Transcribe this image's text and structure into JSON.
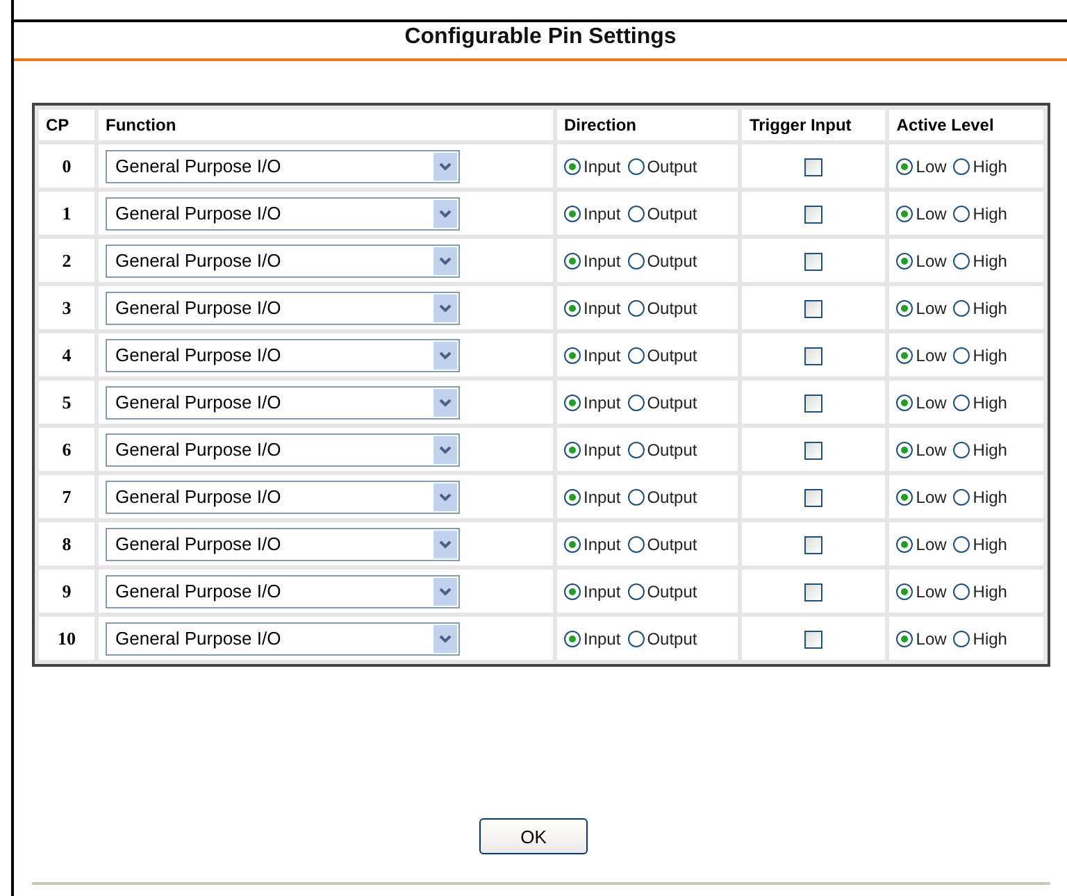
{
  "title": "Configurable Pin Settings",
  "table": {
    "columns": [
      "CP",
      "Function",
      "Direction",
      "Trigger Input",
      "Active Level"
    ],
    "rows": [
      {
        "cp": "0",
        "function": "General Purpose I/O",
        "direction": [
          {
            "label": "Input",
            "selected": true
          },
          {
            "label": "Output",
            "selected": false
          }
        ],
        "trigger_checked": false,
        "active_level": [
          {
            "label": "Low",
            "selected": true
          },
          {
            "label": "High",
            "selected": false
          }
        ]
      },
      {
        "cp": "1",
        "function": "General Purpose I/O",
        "direction": [
          {
            "label": "Input",
            "selected": true
          },
          {
            "label": "Output",
            "selected": false
          }
        ],
        "trigger_checked": false,
        "active_level": [
          {
            "label": "Low",
            "selected": true
          },
          {
            "label": "High",
            "selected": false
          }
        ]
      },
      {
        "cp": "2",
        "function": "General Purpose I/O",
        "direction": [
          {
            "label": "Input",
            "selected": true
          },
          {
            "label": "Output",
            "selected": false
          }
        ],
        "trigger_checked": false,
        "active_level": [
          {
            "label": "Low",
            "selected": true
          },
          {
            "label": "High",
            "selected": false
          }
        ]
      },
      {
        "cp": "3",
        "function": "General Purpose I/O",
        "direction": [
          {
            "label": "Input",
            "selected": true
          },
          {
            "label": "Output",
            "selected": false
          }
        ],
        "trigger_checked": false,
        "active_level": [
          {
            "label": "Low",
            "selected": true
          },
          {
            "label": "High",
            "selected": false
          }
        ]
      },
      {
        "cp": "4",
        "function": "General Purpose I/O",
        "direction": [
          {
            "label": "Input",
            "selected": true
          },
          {
            "label": "Output",
            "selected": false
          }
        ],
        "trigger_checked": false,
        "active_level": [
          {
            "label": "Low",
            "selected": true
          },
          {
            "label": "High",
            "selected": false
          }
        ]
      },
      {
        "cp": "5",
        "function": "General Purpose I/O",
        "direction": [
          {
            "label": "Input",
            "selected": true
          },
          {
            "label": "Output",
            "selected": false
          }
        ],
        "trigger_checked": false,
        "active_level": [
          {
            "label": "Low",
            "selected": true
          },
          {
            "label": "High",
            "selected": false
          }
        ]
      },
      {
        "cp": "6",
        "function": "General Purpose I/O",
        "direction": [
          {
            "label": "Input",
            "selected": true
          },
          {
            "label": "Output",
            "selected": false
          }
        ],
        "trigger_checked": false,
        "active_level": [
          {
            "label": "Low",
            "selected": true
          },
          {
            "label": "High",
            "selected": false
          }
        ]
      },
      {
        "cp": "7",
        "function": "General Purpose I/O",
        "direction": [
          {
            "label": "Input",
            "selected": true
          },
          {
            "label": "Output",
            "selected": false
          }
        ],
        "trigger_checked": false,
        "active_level": [
          {
            "label": "Low",
            "selected": true
          },
          {
            "label": "High",
            "selected": false
          }
        ]
      },
      {
        "cp": "8",
        "function": "General Purpose I/O",
        "direction": [
          {
            "label": "Input",
            "selected": true
          },
          {
            "label": "Output",
            "selected": false
          }
        ],
        "trigger_checked": false,
        "active_level": [
          {
            "label": "Low",
            "selected": true
          },
          {
            "label": "High",
            "selected": false
          }
        ]
      },
      {
        "cp": "9",
        "function": "General Purpose I/O",
        "direction": [
          {
            "label": "Input",
            "selected": true
          },
          {
            "label": "Output",
            "selected": false
          }
        ],
        "trigger_checked": false,
        "active_level": [
          {
            "label": "Low",
            "selected": true
          },
          {
            "label": "High",
            "selected": false
          }
        ]
      },
      {
        "cp": "10",
        "function": "General Purpose I/O",
        "direction": [
          {
            "label": "Input",
            "selected": true
          },
          {
            "label": "Output",
            "selected": false
          }
        ],
        "trigger_checked": false,
        "active_level": [
          {
            "label": "Low",
            "selected": true
          },
          {
            "label": "High",
            "selected": false
          }
        ]
      }
    ]
  },
  "ok_button": "OK"
}
